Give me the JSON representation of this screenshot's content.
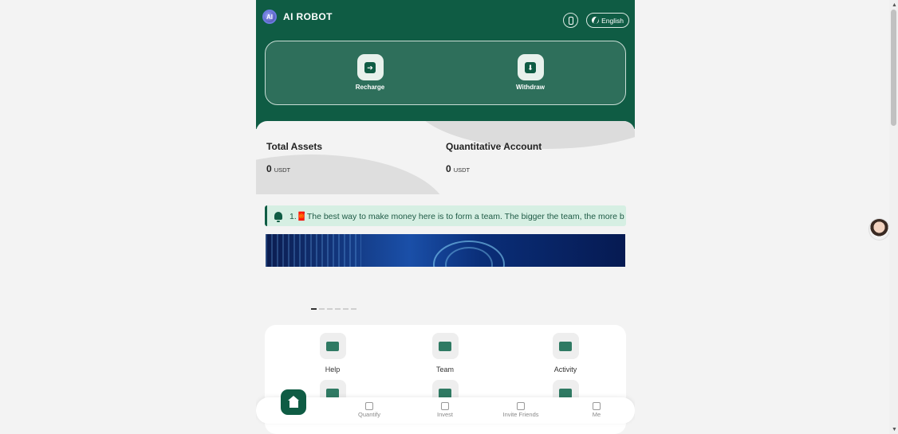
{
  "header": {
    "brand_title": "AI ROBOT",
    "logo_text": "AI",
    "language": "English"
  },
  "actions": [
    {
      "label": "Recharge",
      "icon": "arrow-right-icon"
    },
    {
      "label": "Withdraw",
      "icon": "download-icon"
    }
  ],
  "assets": {
    "total": {
      "title": "Total Assets",
      "value": "0",
      "unit": "USDT"
    },
    "quant": {
      "title": "Quantitative Account",
      "value": "0",
      "unit": "USDT"
    }
  },
  "notice": {
    "text": "1.🧧The best way to make money here is to form a team. The bigger the team, the more b"
  },
  "carousel": {
    "slide_count": 6,
    "active_index": 0
  },
  "tools": [
    {
      "label": "Help",
      "icon": "book-icon"
    },
    {
      "label": "Team",
      "icon": "team-icon"
    },
    {
      "label": "Activity",
      "icon": "gift-icon"
    }
  ],
  "nav": {
    "home_icon": "home-icon",
    "quantify": "Quantify",
    "invest": "Invest",
    "invite": "Invite Friends",
    "me": "Me"
  },
  "colors": {
    "primary": "#0f5c44",
    "notice_bg": "#d6efe3"
  }
}
